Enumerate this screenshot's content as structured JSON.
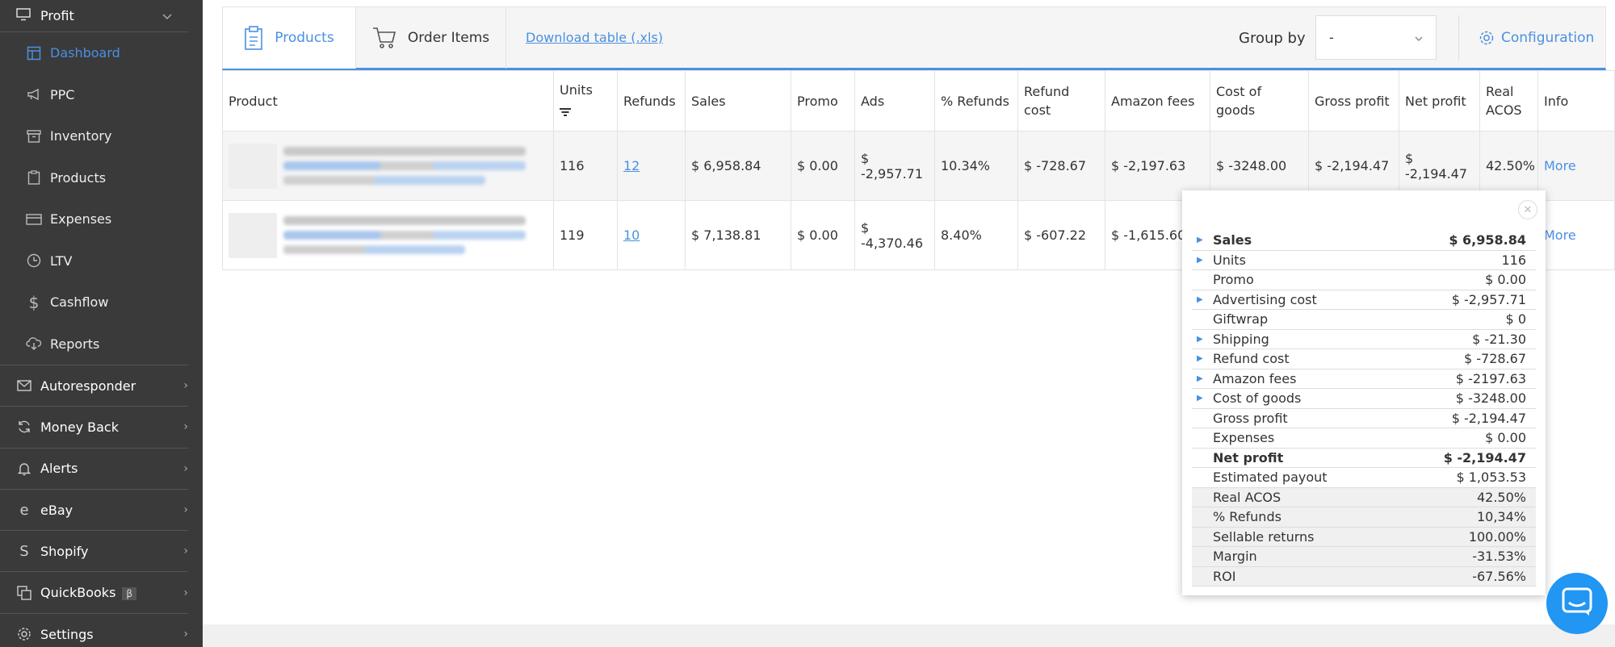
{
  "sidebar": {
    "top": {
      "label": "Profit",
      "icon": "monitor-icon"
    },
    "sub_items": [
      {
        "label": "Dashboard",
        "icon": "dashboard-icon",
        "active": true
      },
      {
        "label": "PPC",
        "icon": "megaphone-icon"
      },
      {
        "label": "Inventory",
        "icon": "inventory-icon"
      },
      {
        "label": "Products",
        "icon": "clipboard-icon"
      },
      {
        "label": "Expenses",
        "icon": "credit-card-icon"
      },
      {
        "label": "LTV",
        "icon": "clock-icon"
      },
      {
        "label": "Cashflow",
        "icon": "dollar-icon"
      },
      {
        "label": "Reports",
        "icon": "cloud-download-icon"
      }
    ],
    "groups": [
      {
        "label": "Autoresponder",
        "icon": "mail-icon"
      },
      {
        "label": "Money Back",
        "icon": "refresh-icon"
      },
      {
        "label": "Alerts",
        "icon": "bell-icon"
      },
      {
        "label": "eBay",
        "icon": "ebay-icon"
      },
      {
        "label": "Shopify",
        "icon": "shopify-icon"
      },
      {
        "label": "QuickBooks",
        "icon": "quickbooks-icon",
        "badge": "β"
      },
      {
        "label": "Settings",
        "icon": "gear-icon"
      }
    ]
  },
  "toolbar": {
    "tab_products": "Products",
    "tab_order_items": "Order Items",
    "download_link": "Download table (.xls)",
    "group_by_label": "Group by",
    "group_by_value": "-",
    "configuration": "Configuration"
  },
  "table": {
    "headers": [
      "Product",
      "Units",
      "Refunds",
      "Sales",
      "Promo",
      "Ads",
      "% Refunds",
      "Refund cost",
      "Amazon fees",
      "Cost of goods",
      "Gross profit",
      "Net profit",
      "Real ACOS",
      "Info"
    ],
    "rows": [
      {
        "units": "116",
        "refunds": "12",
        "sales": "$ 6,958.84",
        "promo": "$ 0.00",
        "ads": "$ -2,957.71",
        "pct_refunds": "10.34%",
        "refund_cost": "$ -728.67",
        "amazon_fees": "$ -2,197.63",
        "cogs": "$ -3248.00",
        "gross": "$ -2,194.47",
        "net": "$ -2,194.47",
        "acos": "42.50%",
        "info": "More"
      },
      {
        "units": "119",
        "refunds": "10",
        "sales": "$ 7,138.81",
        "promo": "$ 0.00",
        "ads": "$ -4,370.46",
        "pct_refunds": "8.40%",
        "refund_cost": "$ -607.22",
        "amazon_fees": "$ -1,615.60",
        "info": "More"
      }
    ]
  },
  "popup": {
    "rows": [
      {
        "label": "Sales",
        "value": "$ 6,958.84",
        "expand": true,
        "bold": true
      },
      {
        "label": "Units",
        "value": "116",
        "expand": true
      },
      {
        "label": "Promo",
        "value": "$ 0.00"
      },
      {
        "label": "Advertising cost",
        "value": "$ -2,957.71",
        "expand": true
      },
      {
        "label": "Giftwrap",
        "value": "$ 0"
      },
      {
        "label": "Shipping",
        "value": "$ -21.30",
        "expand": true
      },
      {
        "label": "Refund cost",
        "value": "$ -728.67",
        "expand": true
      },
      {
        "label": "Amazon fees",
        "value": "$ -2197.63",
        "expand": true
      },
      {
        "label": "Cost of goods",
        "value": "$ -3248.00",
        "expand": true
      },
      {
        "label": "Gross profit",
        "value": "$ -2,194.47"
      },
      {
        "label": "Expenses",
        "value": "$ 0.00"
      },
      {
        "label": "Net profit",
        "value": "$ -2,194.47",
        "bold": true
      },
      {
        "label": "Estimated payout",
        "value": "$ 1,053.53"
      },
      {
        "label": "Real ACOS",
        "value": "42.50%",
        "shade": true
      },
      {
        "label": "% Refunds",
        "value": "10,34%",
        "shade": true
      },
      {
        "label": "Sellable returns",
        "value": "100.00%",
        "shade": true
      },
      {
        "label": "Margin",
        "value": "-31.53%",
        "shade": true
      },
      {
        "label": "ROI",
        "value": "-67.56%",
        "shade": true
      }
    ]
  },
  "colors": {
    "accent": "#4a90e2",
    "sidebar_bg": "#3a3a3a",
    "chat": "#2196f3"
  }
}
